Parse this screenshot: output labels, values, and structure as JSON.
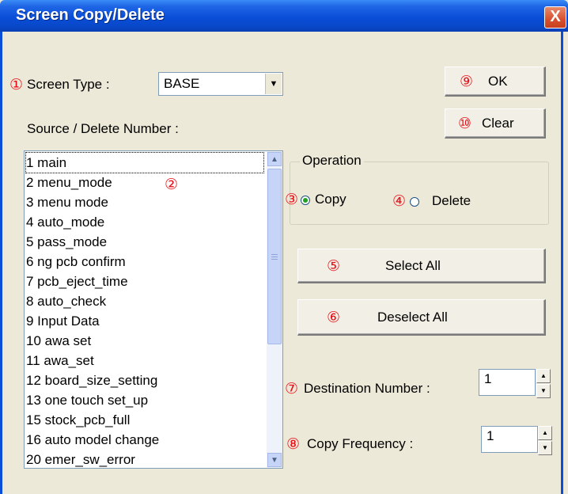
{
  "window": {
    "title": "Screen Copy/Delete",
    "close_glyph": "X"
  },
  "screen_type": {
    "marker": "①",
    "label": "Screen Type :",
    "value": "BASE"
  },
  "source_label": "Source / Delete Number :",
  "list": {
    "marker": "②",
    "items": [
      "1 main",
      "2 menu_mode",
      "3 menu mode",
      "4 auto_mode",
      "5 pass_mode",
      "6 ng pcb confirm",
      "7 pcb_eject_time",
      "8 auto_check",
      "9 Input Data",
      "10 awa set",
      "11 awa_set",
      "12 board_size_setting",
      "13 one touch set_up",
      "15 stock_pcb_full",
      "16 auto model change",
      "20 emer_sw_error"
    ],
    "selected_index": 0
  },
  "operation": {
    "legend": "Operation",
    "copy": {
      "marker": "③",
      "label": "Copy",
      "checked": true
    },
    "delete": {
      "marker": "④",
      "label": "Delete",
      "checked": false
    }
  },
  "buttons": {
    "ok": {
      "marker": "⑨",
      "label": "OK"
    },
    "clear": {
      "marker": "⑩",
      "label": "Clear"
    },
    "select_all": {
      "marker": "⑤",
      "label": "Select All"
    },
    "deselect_all": {
      "marker": "⑥",
      "label": "Deselect All"
    }
  },
  "destination": {
    "marker": "⑦",
    "label": "Destination Number :",
    "value": "1"
  },
  "frequency": {
    "marker": "⑧",
    "label": "Copy Frequency :",
    "value": "1"
  },
  "colors": {
    "title_bar": "#0a4ed8",
    "marker": "#e8101a",
    "dialog_bg": "#ece9d8"
  },
  "icons": {
    "close": "close-icon",
    "combo_arrow": "chevron-down-icon",
    "scroll_up": "scroll-up-icon",
    "scroll_down": "scroll-down-icon",
    "spin_up": "spin-up-icon",
    "spin_down": "spin-down-icon"
  }
}
